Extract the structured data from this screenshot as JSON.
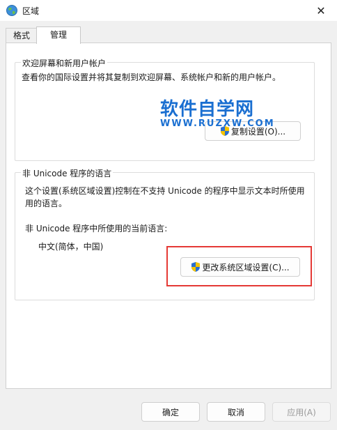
{
  "window": {
    "title": "区域",
    "close_glyph": "✕"
  },
  "tabs": [
    {
      "label": "格式"
    },
    {
      "label": "管理"
    }
  ],
  "welcome_group": {
    "label": "欢迎屏幕和新用户帐户",
    "description": "查看你的国际设置并将其复制到欢迎屏幕、系统帐户和新的用户帐户。",
    "copy_button": "复制设置(O)..."
  },
  "unicode_group": {
    "label": "非 Unicode 程序的语言",
    "description_line1": "这个设置(系统区域设置)控制在不支持 Unicode 的程序中显示文本时所使用",
    "description_line2": "用的语言。",
    "current_label": "非 Unicode 程序中所使用的当前语言:",
    "current_value": "中文(简体，中国)",
    "change_button": "更改系统区域设置(C)..."
  },
  "watermark": {
    "main": "软件自学网",
    "sub": "WWW.RUZXW.COM"
  },
  "footer": {
    "ok": "确定",
    "cancel": "取消",
    "apply": "应用(A)"
  },
  "colors": {
    "highlight": "#e53935",
    "watermark": "#1a6fd1"
  },
  "icons": {
    "title": "globe-icon",
    "shield": "uac-shield-icon",
    "close": "close-icon"
  }
}
